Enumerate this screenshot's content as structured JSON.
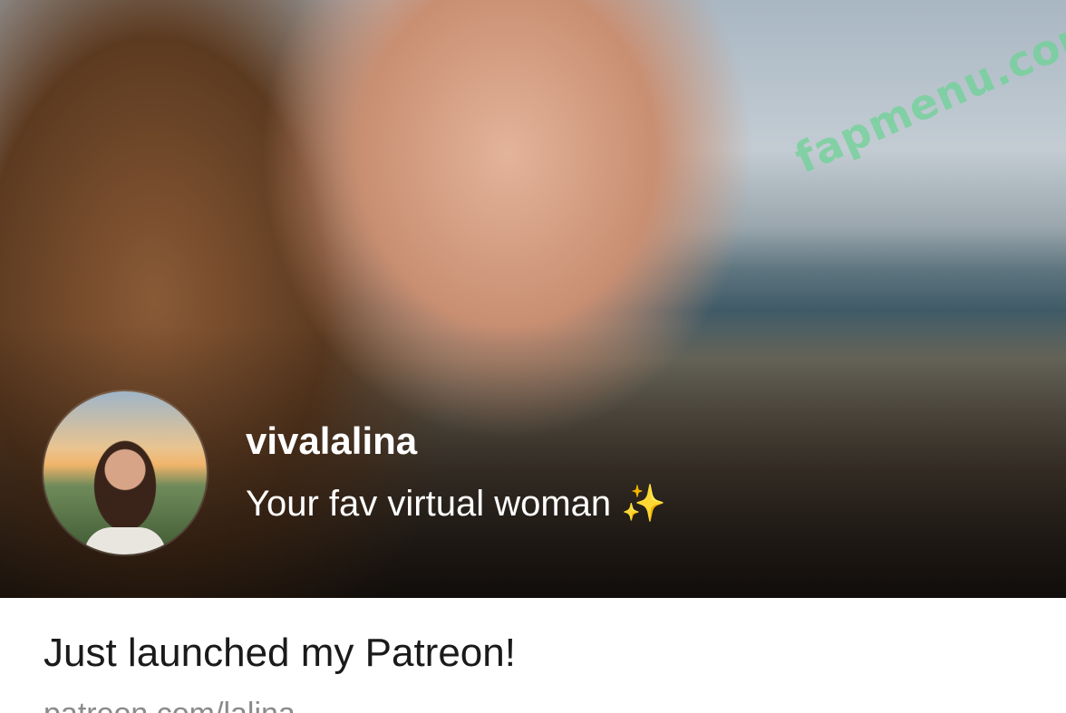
{
  "banner": {
    "image_alt": "profile banner photo",
    "watermark": "fapmenu.com"
  },
  "profile": {
    "name": "vivalalina",
    "tagline": "Your fav virtual woman",
    "tagline_emoji": "✨"
  },
  "post": {
    "title": "Just launched my Patreon!",
    "link": "patreon.com/lalina"
  },
  "colors": {
    "name_text": "#ffffff",
    "title_text": "#1a1a1a",
    "link_text": "#8a8a8a",
    "watermark": "#6ed296"
  }
}
